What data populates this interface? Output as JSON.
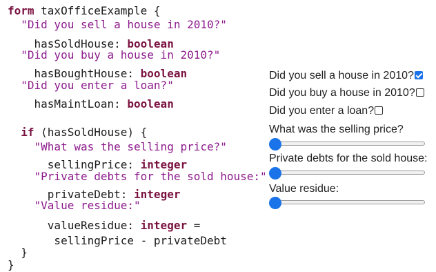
{
  "code": {
    "lines": [
      {
        "parts": [
          {
            "t": "form",
            "c": "kw"
          },
          {
            "t": " taxOfficeExample {",
            "c": ""
          }
        ]
      },
      {
        "parts": [
          {
            "t": "  ",
            "c": ""
          },
          {
            "t": "\"Did you sell a house in 2010?\"",
            "c": "str"
          }
        ]
      },
      {
        "parts": [
          {
            "t": "    hasSoldHouse: ",
            "c": ""
          },
          {
            "t": "boolean",
            "c": "kw"
          }
        ]
      },
      {
        "parts": [
          {
            "t": "  ",
            "c": ""
          },
          {
            "t": "\"Did you buy a house in 2010?\"",
            "c": "str"
          }
        ]
      },
      {
        "parts": [
          {
            "t": "    hasBoughtHouse: ",
            "c": ""
          },
          {
            "t": "boolean",
            "c": "kw"
          }
        ]
      },
      {
        "parts": [
          {
            "t": "  ",
            "c": ""
          },
          {
            "t": "\"Did you enter a loan?\"",
            "c": "str"
          }
        ]
      },
      {
        "parts": [
          {
            "t": "    hasMaintLoan: ",
            "c": ""
          },
          {
            "t": "boolean",
            "c": "kw"
          }
        ]
      },
      {
        "parts": [
          {
            "t": "  ",
            "c": ""
          },
          {
            "t": "if",
            "c": "kw"
          },
          {
            "t": " (hasSoldHouse) {",
            "c": ""
          }
        ]
      },
      {
        "parts": [
          {
            "t": "    ",
            "c": ""
          },
          {
            "t": "\"What was the selling price?\"",
            "c": "str"
          }
        ]
      },
      {
        "parts": [
          {
            "t": "      sellingPrice: ",
            "c": ""
          },
          {
            "t": "integer",
            "c": "kw"
          }
        ]
      },
      {
        "parts": [
          {
            "t": "    ",
            "c": ""
          },
          {
            "t": "\"Private debts for the sold house:\"",
            "c": "str"
          }
        ]
      },
      {
        "parts": [
          {
            "t": "      privateDebt: ",
            "c": ""
          },
          {
            "t": "integer",
            "c": "kw"
          }
        ]
      },
      {
        "parts": [
          {
            "t": "    ",
            "c": ""
          },
          {
            "t": "\"Value residue:\"",
            "c": "str"
          }
        ]
      },
      {
        "parts": [
          {
            "t": "      valueResidue: ",
            "c": ""
          },
          {
            "t": "integer",
            "c": "kw"
          },
          {
            "t": " =",
            "c": ""
          }
        ]
      },
      {
        "parts": [
          {
            "t": "       sellingPrice - privateDebt",
            "c": ""
          }
        ]
      },
      {
        "parts": [
          {
            "t": "  }",
            "c": ""
          }
        ]
      },
      {
        "parts": [
          {
            "t": "}",
            "c": ""
          }
        ]
      }
    ]
  },
  "form": {
    "questions": [
      {
        "label": "Did you sell a house in 2010?",
        "type": "checkbox",
        "checked": true
      },
      {
        "label": "Did you buy a house in 2010?",
        "type": "checkbox",
        "checked": false
      },
      {
        "label": "Did you enter a loan?",
        "type": "checkbox",
        "checked": false
      },
      {
        "label": "What was the selling price?",
        "type": "slider",
        "value": 0
      },
      {
        "label": "Private debts for the sold house:",
        "type": "slider",
        "value": 0
      },
      {
        "label": "Value residue:",
        "type": "slider",
        "value": 0
      }
    ]
  },
  "colors": {
    "accent": "#1a73e8",
    "keyword": "#7a1240",
    "string": "#8c1a8c"
  }
}
